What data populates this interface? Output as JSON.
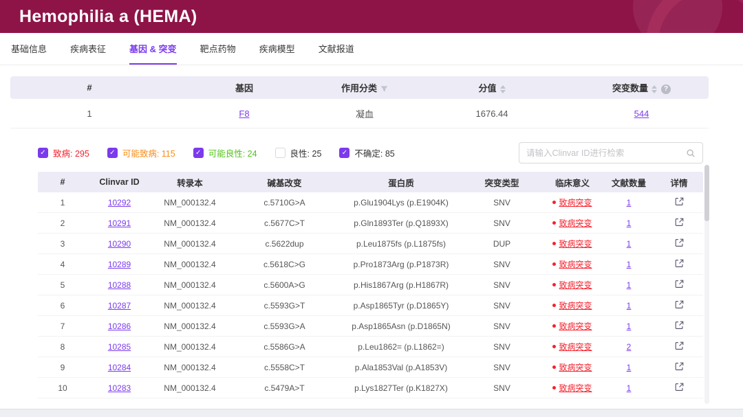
{
  "banner": {
    "title": "Hemophilia a (HEMA)"
  },
  "tabs": [
    {
      "label": "基础信息",
      "active": false
    },
    {
      "label": "疾病表征",
      "active": false
    },
    {
      "label": "基因 & 突变",
      "active": true
    },
    {
      "label": "靶点药物",
      "active": false
    },
    {
      "label": "疾病模型",
      "active": false
    },
    {
      "label": "文献报道",
      "active": false
    }
  ],
  "gene_table": {
    "columns": [
      "#",
      "基因",
      "作用分类",
      "分值",
      "突变数量"
    ],
    "rows": [
      {
        "index": "1",
        "gene": "F8",
        "category": "凝血",
        "score": "1676.44",
        "mutation_count": "544"
      }
    ]
  },
  "filters": [
    {
      "label": "致病: 295",
      "checked": true,
      "color": "#f5222d"
    },
    {
      "label": "可能致病: 115",
      "checked": true,
      "color": "#fa8c16"
    },
    {
      "label": "可能良性: 24",
      "checked": true,
      "color": "#52c41a"
    },
    {
      "label": "良性: 25",
      "checked": false,
      "color": "#333333"
    },
    {
      "label": "不确定: 85",
      "checked": true,
      "color": "#333333"
    }
  ],
  "search": {
    "placeholder": "请输入Clinvar ID进行检索"
  },
  "mutation_table": {
    "columns": [
      "#",
      "Clinvar ID",
      "转录本",
      "碱基改变",
      "蛋白质",
      "突变类型",
      "临床意义",
      "文献数量",
      "详情"
    ],
    "rows": [
      {
        "index": "1",
        "clinvar_id": "10292",
        "transcript": "NM_000132.4",
        "base_change": "c.5710G>A",
        "protein": "p.Glu1904Lys (p.E1904K)",
        "type": "SNV",
        "significance": "致病突变",
        "literature_count": "1"
      },
      {
        "index": "2",
        "clinvar_id": "10291",
        "transcript": "NM_000132.4",
        "base_change": "c.5677C>T",
        "protein": "p.Gln1893Ter (p.Q1893X)",
        "type": "SNV",
        "significance": "致病突变",
        "literature_count": "1"
      },
      {
        "index": "3",
        "clinvar_id": "10290",
        "transcript": "NM_000132.4",
        "base_change": "c.5622dup",
        "protein": "p.Leu1875fs (p.L1875fs)",
        "type": "DUP",
        "significance": "致病突变",
        "literature_count": "1"
      },
      {
        "index": "4",
        "clinvar_id": "10289",
        "transcript": "NM_000132.4",
        "base_change": "c.5618C>G",
        "protein": "p.Pro1873Arg (p.P1873R)",
        "type": "SNV",
        "significance": "致病突变",
        "literature_count": "1"
      },
      {
        "index": "5",
        "clinvar_id": "10288",
        "transcript": "NM_000132.4",
        "base_change": "c.5600A>G",
        "protein": "p.His1867Arg (p.H1867R)",
        "type": "SNV",
        "significance": "致病突变",
        "literature_count": "1"
      },
      {
        "index": "6",
        "clinvar_id": "10287",
        "transcript": "NM_000132.4",
        "base_change": "c.5593G>T",
        "protein": "p.Asp1865Tyr (p.D1865Y)",
        "type": "SNV",
        "significance": "致病突变",
        "literature_count": "1"
      },
      {
        "index": "7",
        "clinvar_id": "10286",
        "transcript": "NM_000132.4",
        "base_change": "c.5593G>A",
        "protein": "p.Asp1865Asn (p.D1865N)",
        "type": "SNV",
        "significance": "致病突变",
        "literature_count": "1"
      },
      {
        "index": "8",
        "clinvar_id": "10285",
        "transcript": "NM_000132.4",
        "base_change": "c.5586G>A",
        "protein": "p.Leu1862= (p.L1862=)",
        "type": "SNV",
        "significance": "致病突变",
        "literature_count": "2"
      },
      {
        "index": "9",
        "clinvar_id": "10284",
        "transcript": "NM_000132.4",
        "base_change": "c.5558C>T",
        "protein": "p.Ala1853Val (p.A1853V)",
        "type": "SNV",
        "significance": "致病突变",
        "literature_count": "1"
      },
      {
        "index": "10",
        "clinvar_id": "10283",
        "transcript": "NM_000132.4",
        "base_change": "c.5479A>T",
        "protein": "p.Lys1827Ter (p.K1827X)",
        "type": "SNV",
        "significance": "致病突变",
        "literature_count": "1"
      }
    ]
  },
  "colors": {
    "banner_bg": "#8e1448",
    "accent_purple": "#7c3aed",
    "pathogenic_red": "#f5222d",
    "likely_pathogenic_orange": "#fa8c16",
    "likely_benign_green": "#52c41a",
    "table_header_bg": "#edebf6"
  }
}
